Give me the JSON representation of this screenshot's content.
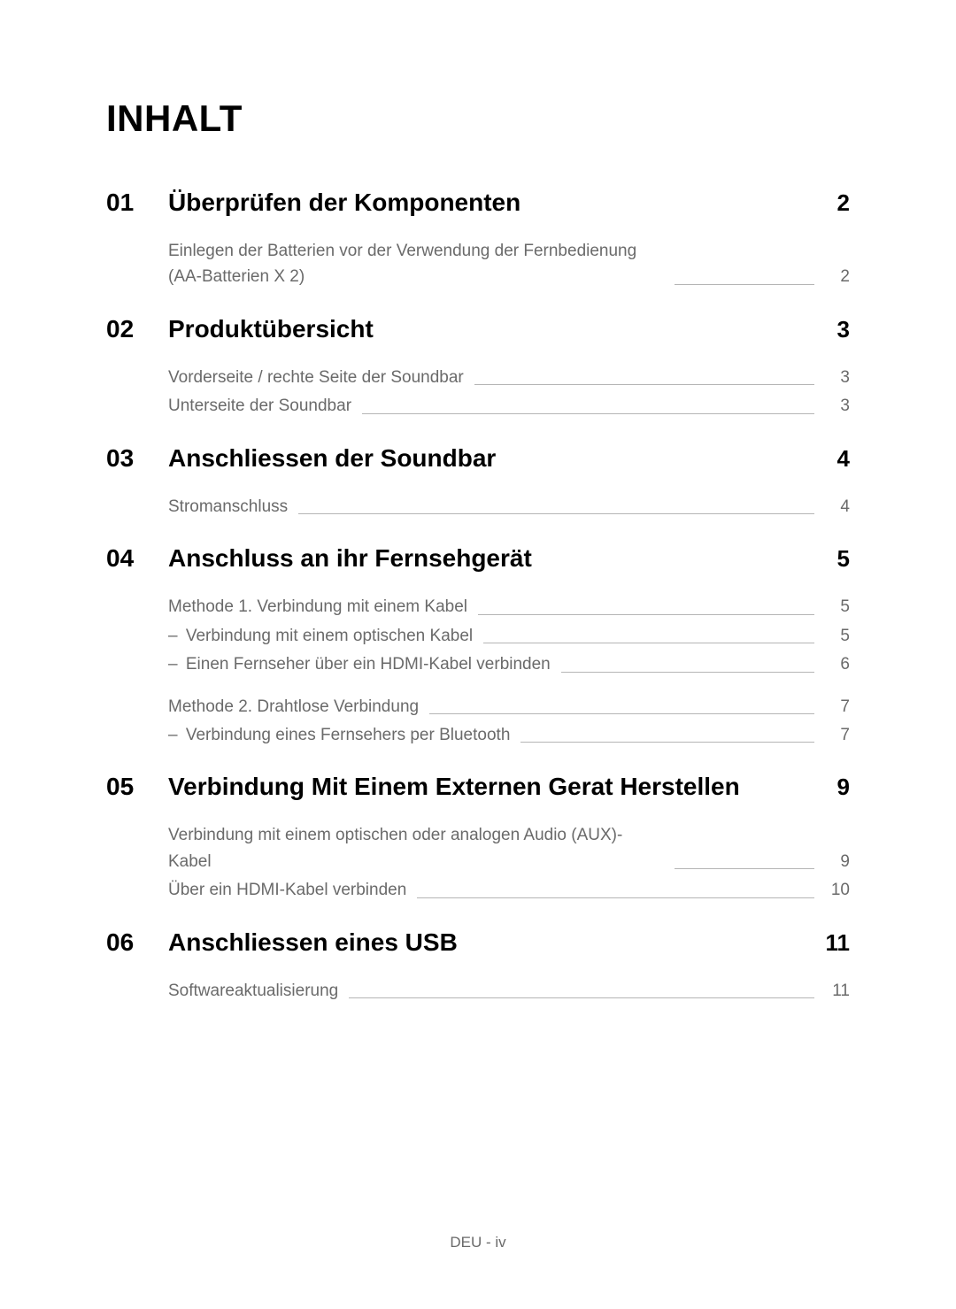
{
  "title": "INHALT",
  "footer": "DEU - iv",
  "sections": [
    {
      "number": "01",
      "title": "Überprüfen der Komponenten",
      "page": "2",
      "groups": [
        {
          "entries": [
            {
              "text": "Einlegen der Batterien vor der Verwendung der Fernbedienung (AA-Batterien X 2)",
              "page": "2",
              "sub": false
            }
          ]
        }
      ]
    },
    {
      "number": "02",
      "title": "Produktübersicht",
      "page": "3",
      "groups": [
        {
          "entries": [
            {
              "text": "Vorderseite / rechte Seite der Soundbar",
              "page": "3",
              "sub": false
            },
            {
              "text": "Unterseite der Soundbar",
              "page": "3",
              "sub": false
            }
          ]
        }
      ]
    },
    {
      "number": "03",
      "title": "Anschliessen der Soundbar",
      "page": "4",
      "groups": [
        {
          "entries": [
            {
              "text": "Stromanschluss",
              "page": "4",
              "sub": false
            }
          ]
        }
      ]
    },
    {
      "number": "04",
      "title": "Anschluss an ihr Fernsehgerät",
      "page": "5",
      "groups": [
        {
          "entries": [
            {
              "text": "Methode 1. Verbindung mit einem Kabel",
              "page": "5",
              "sub": false
            },
            {
              "text": "Verbindung mit einem optischen Kabel",
              "page": "5",
              "sub": true
            },
            {
              "text": "Einen Fernseher über ein HDMI-Kabel verbinden",
              "page": "6",
              "sub": true
            }
          ]
        },
        {
          "entries": [
            {
              "text": "Methode 2. Drahtlose Verbindung",
              "page": "7",
              "sub": false
            },
            {
              "text": "Verbindung eines Fernsehers per Bluetooth",
              "page": "7",
              "sub": true
            }
          ]
        }
      ]
    },
    {
      "number": "05",
      "title": "Verbindung Mit Einem Externen Gerat Herstellen",
      "page": "9",
      "groups": [
        {
          "entries": [
            {
              "text": "Verbindung mit einem optischen oder analogen Audio (AUX)-Kabel",
              "page": "9",
              "sub": false
            },
            {
              "text": "Über ein HDMI-Kabel verbinden",
              "page": "10",
              "sub": false
            }
          ]
        }
      ]
    },
    {
      "number": "06",
      "title": "Anschliessen eines USB",
      "page": "11",
      "groups": [
        {
          "entries": [
            {
              "text": "Softwareaktualisierung",
              "page": "11",
              "sub": false
            }
          ]
        }
      ]
    }
  ]
}
